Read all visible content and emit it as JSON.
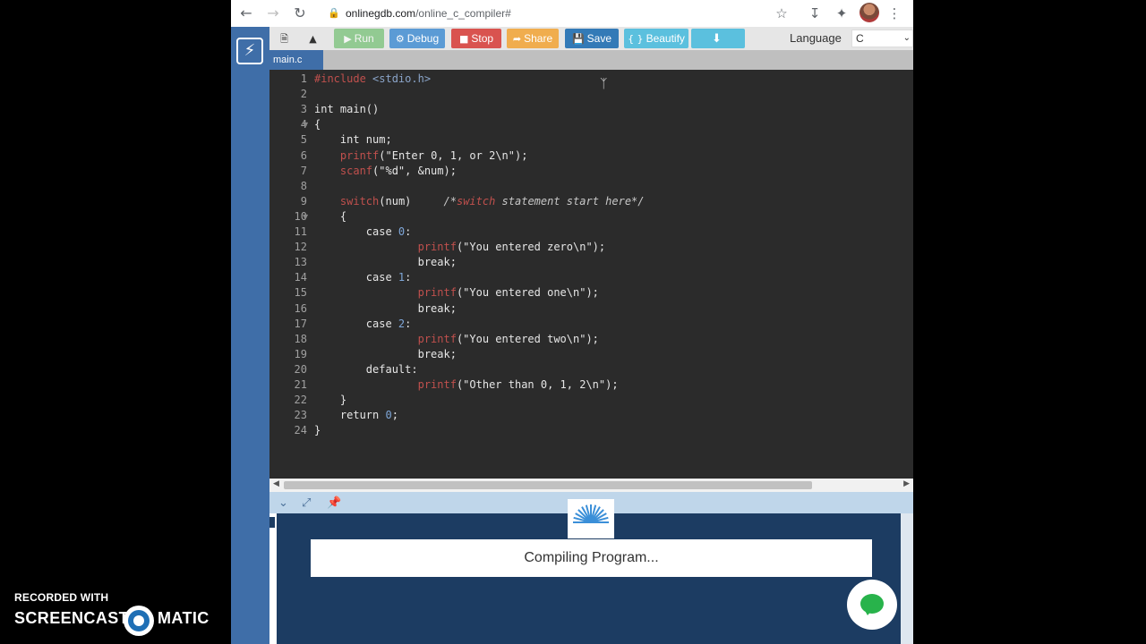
{
  "browser": {
    "url_host": "onlinegdb.com",
    "url_path": "/online_c_compiler#",
    "icons": {
      "back": "arrow-left-icon",
      "forward": "arrow-right-icon",
      "reload": "reload-icon",
      "lock": "lock-icon",
      "star": "star-icon",
      "download": "download-icon",
      "extensions": "puzzle-icon",
      "menu": "kebab-menu-icon"
    }
  },
  "toolbar": {
    "run": "Run",
    "debug": "Debug",
    "stop": "Stop",
    "share": "Share",
    "save": "Save",
    "beautify": "Beautify",
    "language_label": "Language",
    "language_value": "C",
    "colors": {
      "run": "#5cb85c",
      "debug": "#5b9bd5",
      "stop": "#d9534f",
      "share": "#f0ad4e",
      "save": "#337ab7",
      "beautify": "#5bc0de",
      "download": "#5bc0de"
    }
  },
  "file_tab": "main.c",
  "editor": {
    "line_numbers": [
      "1",
      "2",
      "3",
      "4",
      "5",
      "6",
      "7",
      "8",
      "9",
      "10",
      "11",
      "12",
      "13",
      "14",
      "15",
      "16",
      "17",
      "18",
      "19",
      "20",
      "21",
      "22",
      "23",
      "24"
    ],
    "lines": [
      "#include <stdio.h>",
      "",
      "int main()",
      "{",
      "    int num;",
      "    printf(\"Enter 0, 1, or 2\\n\");",
      "    scanf(\"%d\", &num);",
      "",
      "    switch(num)     /*switch statement start here*/",
      "    {",
      "        case 0:",
      "                printf(\"You entered zero\\n\");",
      "                break;",
      "        case 1:",
      "                printf(\"You entered one\\n\");",
      "                break;",
      "        case 2:",
      "                printf(\"You entered two\\n\");",
      "                break;",
      "        default:",
      "                printf(\"Other than 0, 1, 2\\n\");",
      "    }",
      "    return 0;",
      "}"
    ]
  },
  "console": {
    "status": "Compiling Program..."
  },
  "watermark": {
    "top": "RECORDED WITH",
    "left": "SCREENCAST",
    "right": "MATIC"
  }
}
